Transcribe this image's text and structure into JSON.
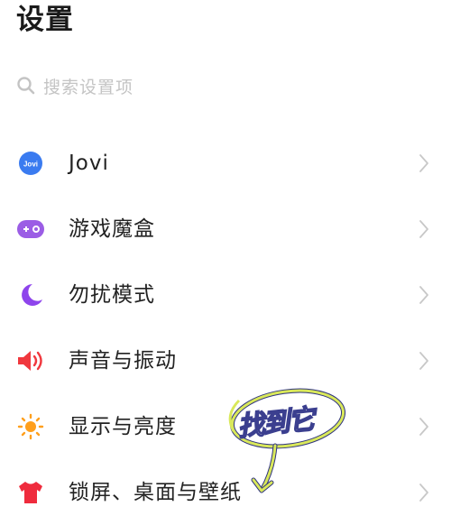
{
  "header": {
    "title": "设置"
  },
  "search": {
    "placeholder": "搜索设置项"
  },
  "items": [
    {
      "label": "Jovi",
      "icon": "jovi-icon",
      "badge_text": "Jovi",
      "color": "#3a7bf0"
    },
    {
      "label": "游戏魔盒",
      "icon": "game-box-icon",
      "color": "#9b5de5"
    },
    {
      "label": "勿扰模式",
      "icon": "moon-icon",
      "color": "#8e44ec"
    },
    {
      "label": "声音与振动",
      "icon": "speaker-icon",
      "color": "#f0383e"
    },
    {
      "label": "显示与亮度",
      "icon": "sun-icon",
      "color": "#ff9f1c"
    },
    {
      "label": "锁屏、桌面与壁纸",
      "icon": "tshirt-icon",
      "color": "#ef2b3d"
    }
  ],
  "annotation": {
    "text": "找到它",
    "colors": {
      "outline": "#d9e85a",
      "text_stroke": "#3b3f8f"
    }
  }
}
